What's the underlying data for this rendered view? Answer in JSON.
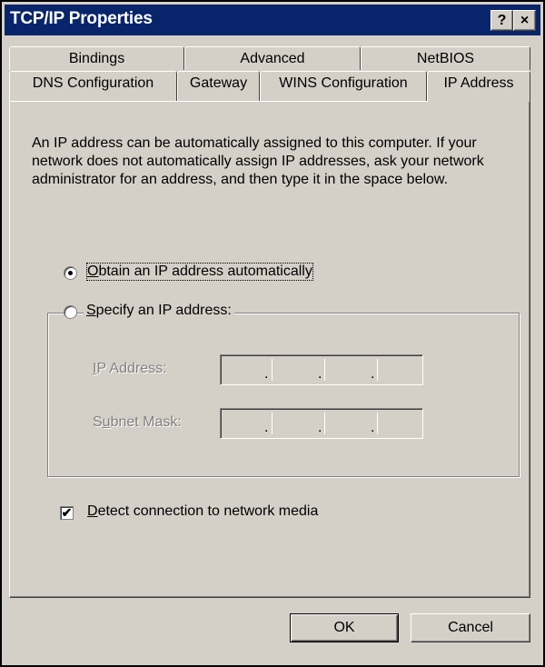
{
  "window": {
    "title": "TCP/IP Properties",
    "help_label": "?",
    "close_label": "×"
  },
  "tabs_back": [
    {
      "label": "Bindings"
    },
    {
      "label": "Advanced"
    },
    {
      "label": "NetBIOS"
    }
  ],
  "tabs_front": [
    {
      "label": "DNS Configuration"
    },
    {
      "label": "Gateway"
    },
    {
      "label": "WINS Configuration"
    },
    {
      "label": "IP Address",
      "active": true
    }
  ],
  "description": "An IP address can be automatically assigned to this computer. If your network does not automatically assign IP addresses, ask your network administrator for an address, and then type it in the space below.",
  "options": {
    "auto": {
      "mnemonic": "O",
      "rest": "btain an IP address automatically",
      "selected": true
    },
    "specify": {
      "mnemonic": "S",
      "rest": "pecify an IP address:",
      "selected": false
    }
  },
  "fields": {
    "ip_address": {
      "label_pre": "",
      "mnemonic": "I",
      "label_post": "P Address:",
      "value": ". . ."
    },
    "subnet_mask": {
      "label_pre": "S",
      "mnemonic": "u",
      "label_post": "bnet Mask:",
      "value": ". . ."
    }
  },
  "detect": {
    "mnemonic": "D",
    "rest": "etect connection to network media",
    "checked": true
  },
  "buttons": {
    "ok": "OK",
    "cancel": "Cancel"
  }
}
